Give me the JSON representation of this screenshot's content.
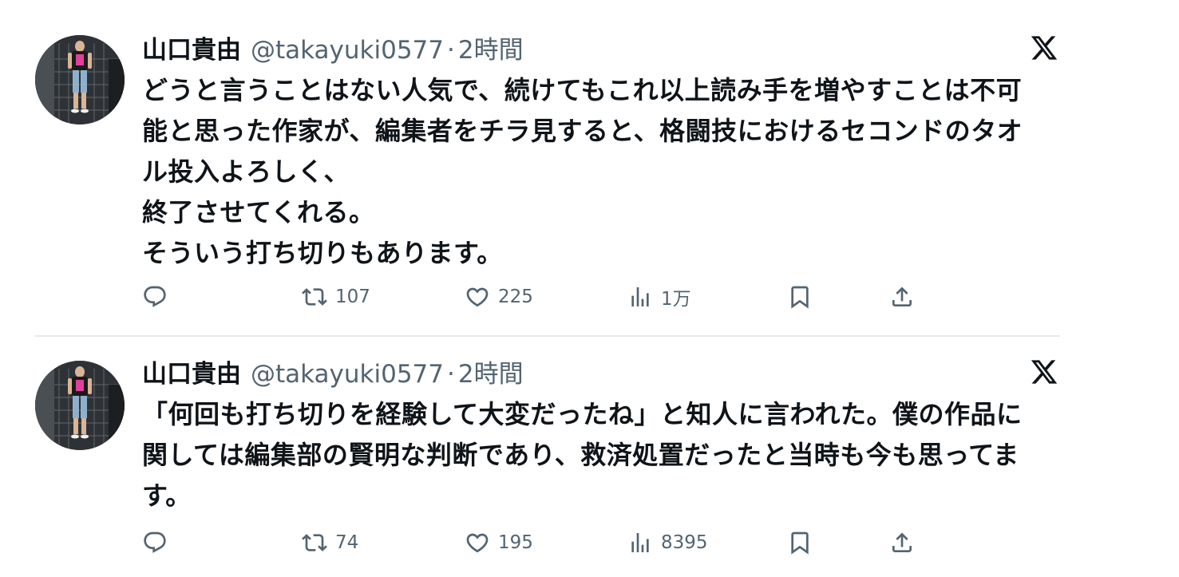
{
  "tweets": [
    {
      "author_name": "山口貴由",
      "handle": "@takayuki0577",
      "separator": "·",
      "time": "2時間",
      "text": "どうと言うことはない人気で、続けてもこれ以上読み手を増やすことは不可\n能と思った作家が、編集者をチラ見すると、格闘技におけるセコンドのタオ\nル投入よろしく、\n終了させてくれる。\nそういう打ち切りもあります。",
      "retweets": "107",
      "likes": "225",
      "views": "1万"
    },
    {
      "author_name": "山口貴由",
      "handle": "@takayuki0577",
      "separator": "·",
      "time": "2時間",
      "text": "「何回も打ち切りを経験して大変だったね」と知人に言われた。僕の作品に\n関しては編集部の賢明な判断であり、救済処置だったと当時も今も思ってま\nす。",
      "retweets": "74",
      "likes": "195",
      "views": "8395"
    }
  ],
  "icons": {
    "brand": "x-logo-icon",
    "reply": "reply-icon",
    "retweet": "retweet-icon",
    "like": "heart-icon",
    "views": "views-chart-icon",
    "bookmark": "bookmark-icon",
    "share": "share-icon"
  },
  "colors": {
    "text": "#0f1419",
    "secondary": "#536471",
    "divider": "#e6e9eb",
    "background": "#ffffff"
  }
}
